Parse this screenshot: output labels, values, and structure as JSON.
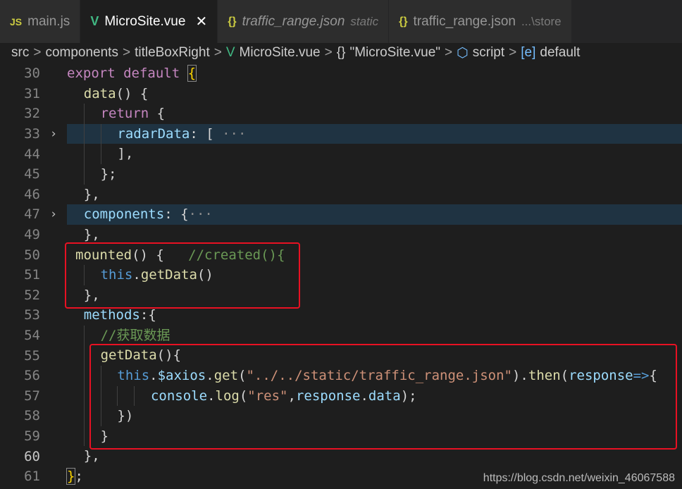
{
  "tabs": [
    {
      "icon": "JS",
      "label": "main.js",
      "active": false
    },
    {
      "icon": "V",
      "label": "MicroSite.vue",
      "active": true,
      "close": "✕"
    },
    {
      "icon": "{}",
      "label": "traffic_range.json",
      "desc": "static",
      "active": false
    },
    {
      "icon": "{}",
      "label": "traffic_range.json",
      "desc": "...\\store",
      "active": false
    }
  ],
  "breadcrumb": {
    "items": [
      "src",
      "components",
      "titleBoxRight",
      "MicroSite.vue",
      "\"MicroSite.vue\"",
      "script",
      "default"
    ],
    "separator": ">"
  },
  "lines": [
    {
      "no": "30",
      "t": [
        "export",
        " ",
        "default",
        " ",
        "{"
      ]
    },
    {
      "no": "31",
      "t": [
        "data",
        "() {"
      ]
    },
    {
      "no": "32",
      "t": [
        "return",
        " {"
      ]
    },
    {
      "no": "33",
      "t": [
        "radarData",
        ": [ ",
        "···"
      ]
    },
    {
      "no": "44",
      "t": [
        "],"
      ]
    },
    {
      "no": "45",
      "t": [
        "};"
      ]
    },
    {
      "no": "46",
      "t": [
        "},"
      ]
    },
    {
      "no": "47",
      "t": [
        "components",
        ": {",
        "···"
      ]
    },
    {
      "no": "49",
      "t": [
        "},"
      ]
    },
    {
      "no": "50",
      "t": [
        "mounted",
        "() {",
        "   ",
        "//created(){"
      ]
    },
    {
      "no": "51",
      "t": [
        "this",
        ".",
        "getData",
        "()"
      ]
    },
    {
      "no": "52",
      "t": [
        "},"
      ]
    },
    {
      "no": "53",
      "t": [
        "methods",
        ":{"
      ]
    },
    {
      "no": "54",
      "t": [
        "//获取数据"
      ]
    },
    {
      "no": "55",
      "t": [
        "getData",
        "(){"
      ]
    },
    {
      "no": "56",
      "t": [
        "this",
        ".",
        "$axios",
        ".",
        "get",
        "(",
        "\"../../static/traffic_range.json\"",
        ").",
        "then",
        "(",
        "response",
        "=>",
        "{"
      ]
    },
    {
      "no": "57",
      "t": [
        "console",
        ".",
        "log",
        "(",
        "\"res\"",
        ",",
        "response",
        ".",
        "data",
        ");"
      ]
    },
    {
      "no": "58",
      "t": [
        "})"
      ]
    },
    {
      "no": "59",
      "t": [
        "}"
      ]
    },
    {
      "no": "60",
      "t": [
        "},"
      ]
    },
    {
      "no": "61",
      "t": [
        "}",
        ";"
      ]
    }
  ],
  "fold_glyph": "›",
  "watermark": "https://blog.csdn.net/weixin_46067588"
}
